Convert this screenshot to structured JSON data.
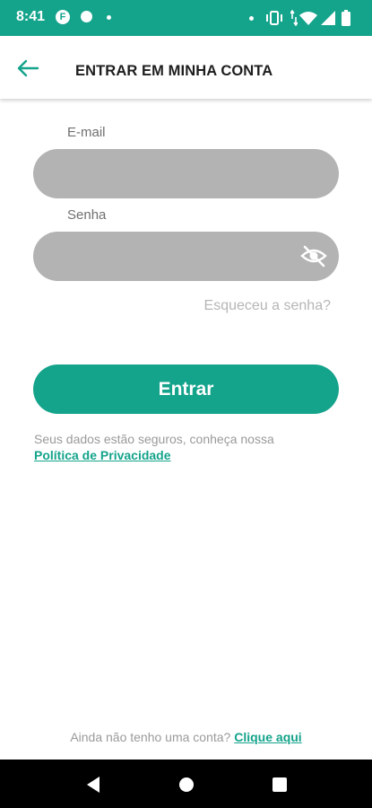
{
  "status_bar": {
    "time": "8:41",
    "app_icon_letter": "F",
    "background_color": "#14a38b",
    "icons": [
      "facebook-icon",
      "chat-bubble-icon",
      "notification-dot",
      "notification-dot",
      "vibrate-icon",
      "data-arrows-icon",
      "wifi-icon",
      "signal-icon",
      "battery-icon"
    ]
  },
  "header": {
    "title": "ENTRAR EM MINHA CONTA",
    "back_icon": "arrow-left-icon",
    "accent_color": "#14a38b"
  },
  "form": {
    "email_label": "E-mail",
    "email_value": "",
    "password_label": "Senha",
    "password_value": "",
    "password_toggle_icon": "eye-off-icon",
    "forgot_password": "Esqueceu a senha?",
    "submit_label": "Entrar",
    "input_background": "#b3b3b3"
  },
  "privacy": {
    "text": "Seus dados estão seguros, conheça nossa",
    "link": "Política de Privacidade"
  },
  "signup": {
    "text": "Ainda não tenho uma conta? ",
    "link": "Clique aqui"
  },
  "nav_bar": {
    "buttons": [
      "back-triangle-icon",
      "home-circle-icon",
      "recents-square-icon"
    ]
  }
}
